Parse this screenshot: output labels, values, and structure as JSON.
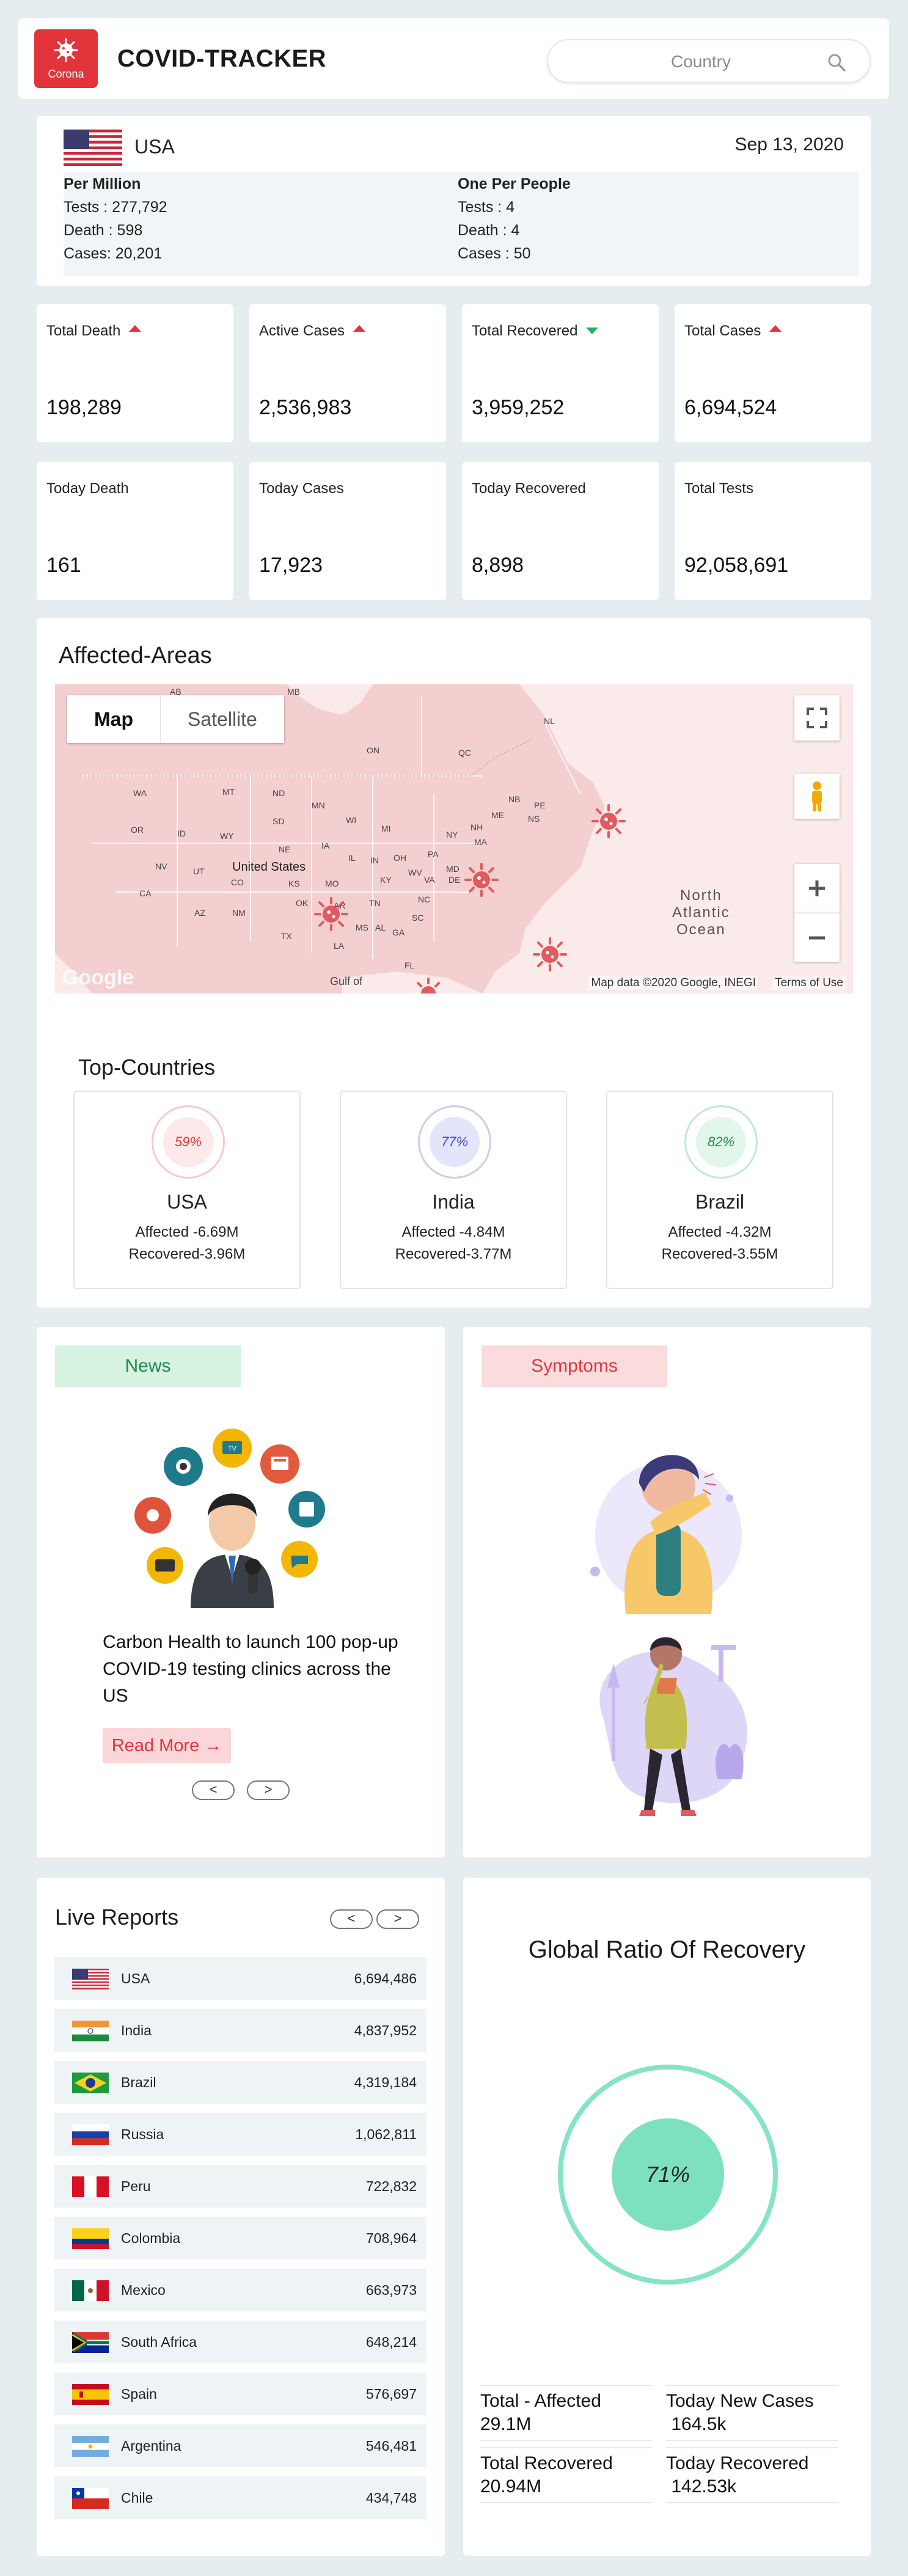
{
  "header": {
    "logo_text": "Corona",
    "brand": "COVID-TRACKER",
    "search_placeholder": "Country",
    "icons": {
      "logo": "virus-icon",
      "search": "search-icon"
    }
  },
  "country_info": {
    "name": "USA",
    "date": "Sep 13, 2020",
    "per_million": {
      "title": "Per Million",
      "tests": "Tests   : 277,792",
      "death": "Death : 598",
      "cases": "Cases: 20,201"
    },
    "one_per_people": {
      "title": "One Per People",
      "tests": "Tests   : 4",
      "death": "Death : 4",
      "cases": "Cases : 50"
    }
  },
  "stats_row1": [
    {
      "label": "Total Death",
      "value": "198,289",
      "trend": "up"
    },
    {
      "label": "Active Cases",
      "value": "2,536,983",
      "trend": "up"
    },
    {
      "label": "Total Recovered",
      "value": "3,959,252",
      "trend": "down"
    },
    {
      "label": "Total Cases",
      "value": "6,694,524",
      "trend": "up"
    }
  ],
  "stats_row2": [
    {
      "label": "Today Death",
      "value": "161"
    },
    {
      "label": "Today Cases",
      "value": "17,923"
    },
    {
      "label": "Today Recovered",
      "value": "8,898"
    },
    {
      "label": "Total Tests",
      "value": "92,058,691"
    }
  ],
  "affected": {
    "title": "Affected-Areas",
    "map_type": {
      "map": "Map",
      "satellite": "Satellite"
    },
    "labels": {
      "us": "United States",
      "gulf": "Gulf of",
      "ocean1": "North",
      "ocean2": "Atlantic",
      "ocean3": "Ocean",
      "ab": "AB",
      "mb": "MB",
      "on": "ON",
      "qc": "QC",
      "nl": "NL",
      "nb": "NB",
      "pe": "PE",
      "ns": "NS",
      "me": "ME",
      "wa": "WA",
      "mt": "MT",
      "nd": "ND",
      "mn": "MN",
      "or": "OR",
      "id": "ID",
      "wy": "WY",
      "sd": "SD",
      "wi": "WI",
      "mi": "MI",
      "ny": "NY",
      "nh": "NH",
      "ma": "MA",
      "nv": "NV",
      "ut": "UT",
      "ne": "NE",
      "ia": "IA",
      "il": "IL",
      "in": "IN",
      "oh": "OH",
      "pa": "PA",
      "co": "CO",
      "ks": "KS",
      "mo": "MO",
      "ky": "KY",
      "wv": "WV",
      "va": "VA",
      "md": "MD",
      "de": "DE",
      "ca": "CA",
      "az": "AZ",
      "nm": "NM",
      "ok": "OK",
      "ar": "AR",
      "tn": "TN",
      "nc": "NC",
      "sc": "SC",
      "tx": "TX",
      "la": "LA",
      "ms": "MS",
      "al": "AL",
      "ga": "GA",
      "fl": "FL"
    },
    "google": "Google",
    "map_data": "Map data ©2020 Google, INEGI",
    "terms": "Terms of Use"
  },
  "top_countries": {
    "title": "Top-Countries",
    "items": [
      {
        "name": "USA",
        "percent": "59%",
        "affected": "Affected -6.69M",
        "recovered": "Recovered-3.96M",
        "ring_color": "#f7c9cb",
        "inner_color": "#fde9ea",
        "text_color": "#e2353b"
      },
      {
        "name": "India",
        "percent": "77%",
        "affected": "Affected -4.84M",
        "recovered": "Recovered-3.77M",
        "ring_color": "#c9cdf3",
        "inner_color": "#e3e6fb",
        "text_color": "#3b4ad8"
      },
      {
        "name": "Brazil",
        "percent": "82%",
        "affected": "Affected -4.32M",
        "recovered": "Recovered-3.55M",
        "ring_color": "#bfe9d0",
        "inner_color": "#e2f6ea",
        "text_color": "#1f8b4c"
      }
    ]
  },
  "news": {
    "tab": "News",
    "headline": "Carbon Health to launch 100 pop-up COVID-19 testing clinics across the US",
    "read_more": "Read More",
    "arrow": "→",
    "prev": "<",
    "next": ">"
  },
  "symptoms": {
    "tab": "Symptoms"
  },
  "live_reports": {
    "title": "Live Reports",
    "prev": "<",
    "next": ">",
    "rows": [
      {
        "country": "USA",
        "count": "6,694,486"
      },
      {
        "country": "India",
        "count": "4,837,952"
      },
      {
        "country": "Brazil",
        "count": "4,319,184"
      },
      {
        "country": "Russia",
        "count": "1,062,811"
      },
      {
        "country": "Peru",
        "count": "722,832"
      },
      {
        "country": "Colombia",
        "count": "708,964"
      },
      {
        "country": "Mexico",
        "count": "663,973"
      },
      {
        "country": "South Africa",
        "count": "648,214"
      },
      {
        "country": "Spain",
        "count": "576,697"
      },
      {
        "country": "Argentina",
        "count": "546,481"
      },
      {
        "country": "Chile",
        "count": "434,748"
      }
    ]
  },
  "global_ratio": {
    "title": "Global Ratio Of Recovery",
    "percent": "71%",
    "total_affected_label": "Total - Affected",
    "total_affected": "29.1M",
    "today_new_label": "Today New Cases",
    "today_new": " 164.5k",
    "total_recovered_label": "Total Recovered",
    "total_recovered": "20.94M",
    "today_recovered_label": "Today Recovered",
    "today_recovered": " 142.53k"
  },
  "colors": {
    "accent_red": "#e2353b",
    "green": "#22b35a",
    "page_bg": "#e6edf1",
    "map_land": "#f3cfd0",
    "recovery": "#7ee1bd"
  }
}
